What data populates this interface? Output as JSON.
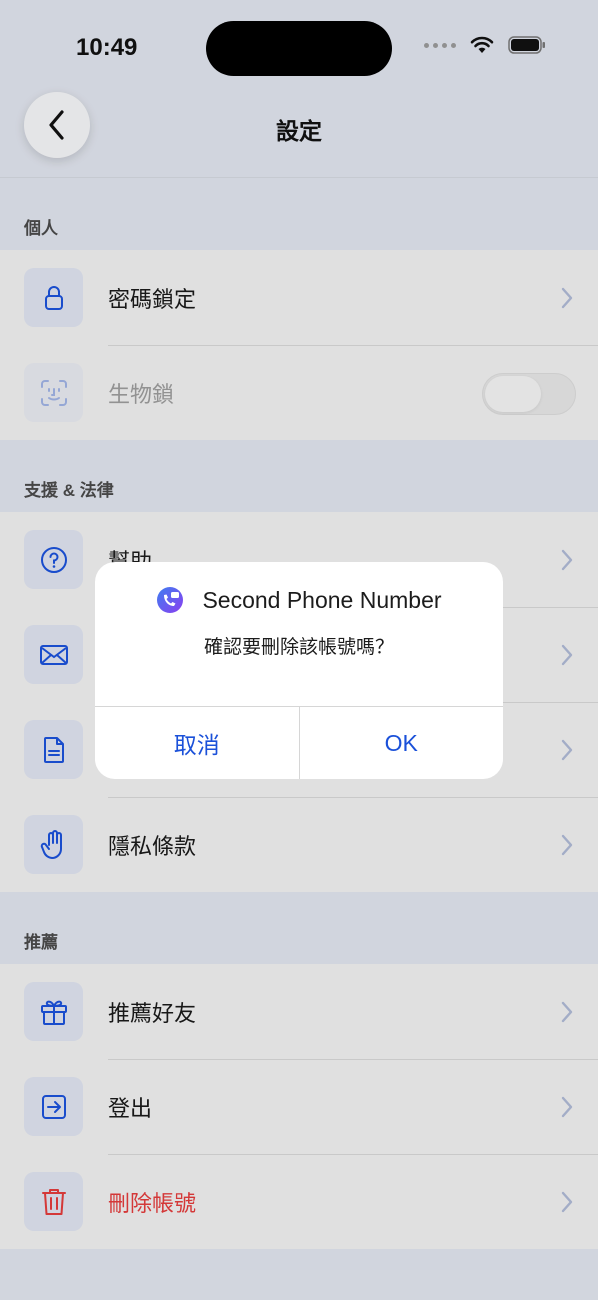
{
  "status_bar": {
    "time": "10:49"
  },
  "nav": {
    "title": "設定",
    "back_icon": "chevron-left-icon"
  },
  "sections": [
    {
      "header": "個人",
      "items": [
        {
          "label": "密碼鎖定",
          "icon": "lock-icon",
          "trailing": "chevron"
        },
        {
          "label": "生物鎖",
          "icon": "face-id-icon",
          "trailing": "toggle",
          "toggle_on": false,
          "disabled": true
        }
      ]
    },
    {
      "header": "支援 & 法律",
      "items": [
        {
          "label": "幫助",
          "icon": "help-circle-icon"
        },
        {
          "label": "",
          "icon": "mail-icon"
        },
        {
          "label": "",
          "icon": "document-icon"
        },
        {
          "label": "隱私條款",
          "icon": "hand-icon"
        }
      ]
    },
    {
      "header": "推薦",
      "items": [
        {
          "label": "推薦好友",
          "icon": "gift-icon"
        },
        {
          "label": "登出",
          "icon": "logout-icon"
        },
        {
          "label": "刪除帳號",
          "icon": "trash-icon",
          "danger": true
        }
      ]
    }
  ],
  "dialog": {
    "app_name": "Second Phone Number",
    "message": "確認要刪除該帳號嗎？",
    "cancel_label": "取消",
    "ok_label": "OK"
  },
  "colors": {
    "accent": "#1b51d9",
    "danger": "#e23c3c",
    "icon_bg": "#dde2ee"
  }
}
